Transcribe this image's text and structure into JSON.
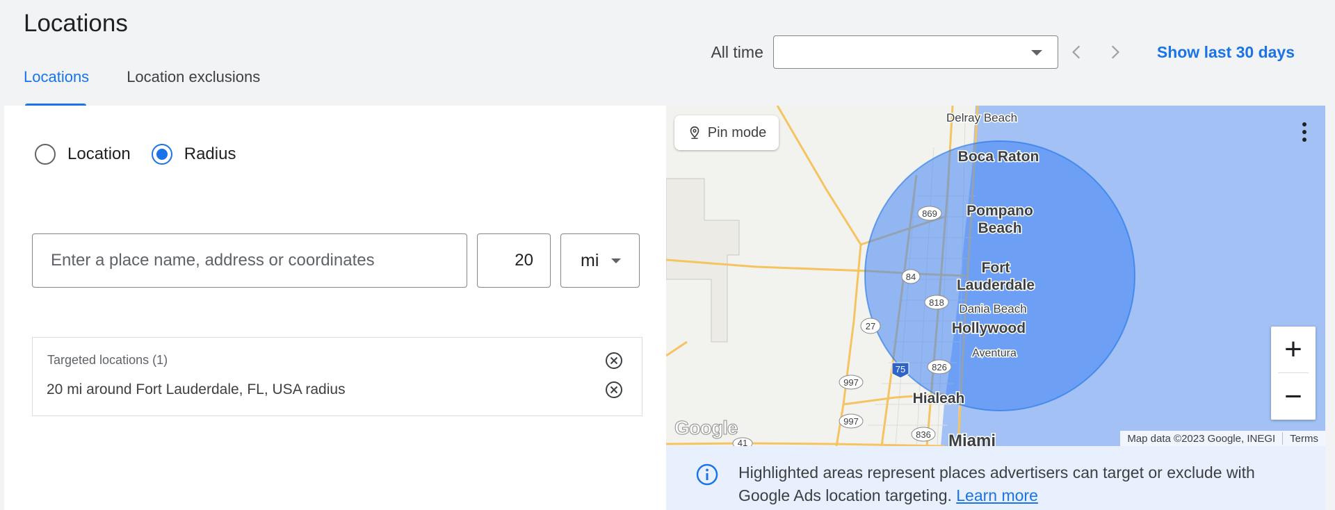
{
  "page": {
    "title": "Locations"
  },
  "tabs": [
    {
      "label": "Locations",
      "active": true
    },
    {
      "label": "Location exclusions",
      "active": false
    }
  ],
  "toolbar": {
    "date_label": "All time",
    "date_value": "",
    "prev_icon": "chevron-left-icon",
    "next_icon": "chevron-right-icon",
    "show_last": "Show last 30 days"
  },
  "targeting": {
    "options": [
      {
        "label": "Location",
        "checked": false
      },
      {
        "label": "Radius",
        "checked": true
      }
    ],
    "search_placeholder": "Enter a place name, address or coordinates",
    "radius_value": "20",
    "unit": "mi"
  },
  "targeted": {
    "header": "Targeted locations (1)",
    "items": [
      "20 mi around Fort Lauderdale, FL, USA radius"
    ]
  },
  "map": {
    "pin_mode": "Pin mode",
    "labels": {
      "delray": "Delray Beach",
      "boca": "Boca Raton",
      "pompano1": "Pompano",
      "pompano2": "Beach",
      "fort1": "Fort",
      "fort2": "Lauderdale",
      "dania": "Dania Beach",
      "hollywood": "Hollywood",
      "aventura": "Aventura",
      "hialeah": "Hialeah",
      "miami": "Miami"
    },
    "route_shields": [
      "869",
      "84",
      "818",
      "27",
      "75",
      "826",
      "997",
      "997",
      "836",
      "41"
    ],
    "logo": "Google",
    "attribution": "Map data ©2023 Google, INEGI",
    "terms": "Terms",
    "zoom_in": "+",
    "zoom_out": "−",
    "radius_fill": "#4285f4"
  },
  "info": {
    "text": "Highlighted areas represent places advertisers can target or exclude with Google Ads location targeting.",
    "link": "Learn more"
  }
}
